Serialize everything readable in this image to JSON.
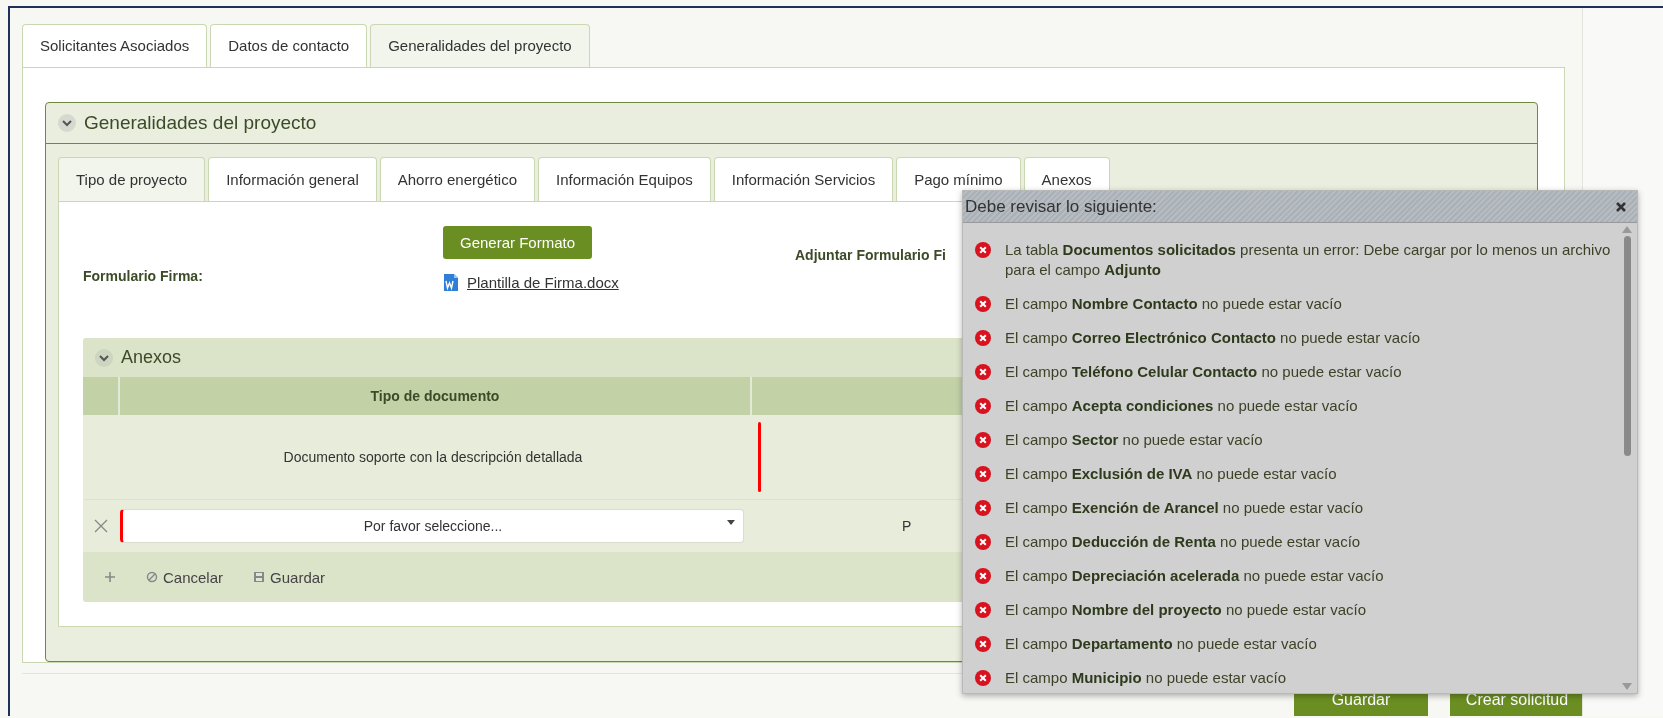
{
  "top_tabs": [
    {
      "label": "Solicitantes Asociados",
      "selected": false
    },
    {
      "label": "Datos de contacto",
      "selected": false
    },
    {
      "label": "Generalidades del proyecto",
      "selected": true
    }
  ],
  "panel": {
    "title": "Generalidades del proyecto",
    "expanded": true
  },
  "inner_tabs": [
    {
      "label": "Tipo de proyecto",
      "selected": true
    },
    {
      "label": "Información general",
      "selected": false
    },
    {
      "label": "Ahorro energético",
      "selected": false
    },
    {
      "label": "Información Equipos",
      "selected": false
    },
    {
      "label": "Información Servicios",
      "selected": false
    },
    {
      "label": "Pago mínimo",
      "selected": false
    },
    {
      "label": "Anexos",
      "selected": false
    }
  ],
  "form": {
    "label": "Formulario Firma:",
    "button": "Generar Formato",
    "file_link": "Plantilla de Firma.docx",
    "attach_label": "Adjuntar Formulario Fi"
  },
  "annexes": {
    "title": "Anexos",
    "expanded": true,
    "columns": [
      "Tipo de documento"
    ],
    "rows": [
      {
        "cells": [
          "Documento soporte con la descripción detallada"
        ],
        "invalid": true
      }
    ],
    "edit_row": {
      "placeholder": "Por favor seleccione...",
      "invalid": true,
      "column_3": "P"
    },
    "toolbar": [
      "Cancelar",
      "Guardar"
    ]
  },
  "popup": {
    "title": "Debe revisar lo siguiente:",
    "messages": [
      "La tabla **Documentos solicitados** presenta un error: Debe cargar por lo menos un archivo para el campo **Adjunto**",
      "El campo **Nombre Contacto** no puede estar vacío",
      "El campo **Correo Electrónico Contacto** no puede estar vacío",
      "El campo **Teléfono Celular Contacto** no puede estar vacío",
      "El campo **Acepta condiciones** no puede estar vacío",
      "El campo **Sector** no puede estar vacío",
      "El campo **Exclusión de IVA** no puede estar vacío",
      "El campo **Exención de Arancel** no puede estar vacío",
      "El campo **Deducción de Renta** no puede estar vacío",
      "El campo **Depreciación acelerada** no puede estar vacío",
      "El campo **Nombre del proyecto** no puede estar vacío",
      "El campo **Departamento** no puede estar vacío",
      "El campo **Municipio** no puede estar vacío"
    ]
  },
  "footer_buttons": [
    "Guardar",
    "Crear solicitud"
  ]
}
